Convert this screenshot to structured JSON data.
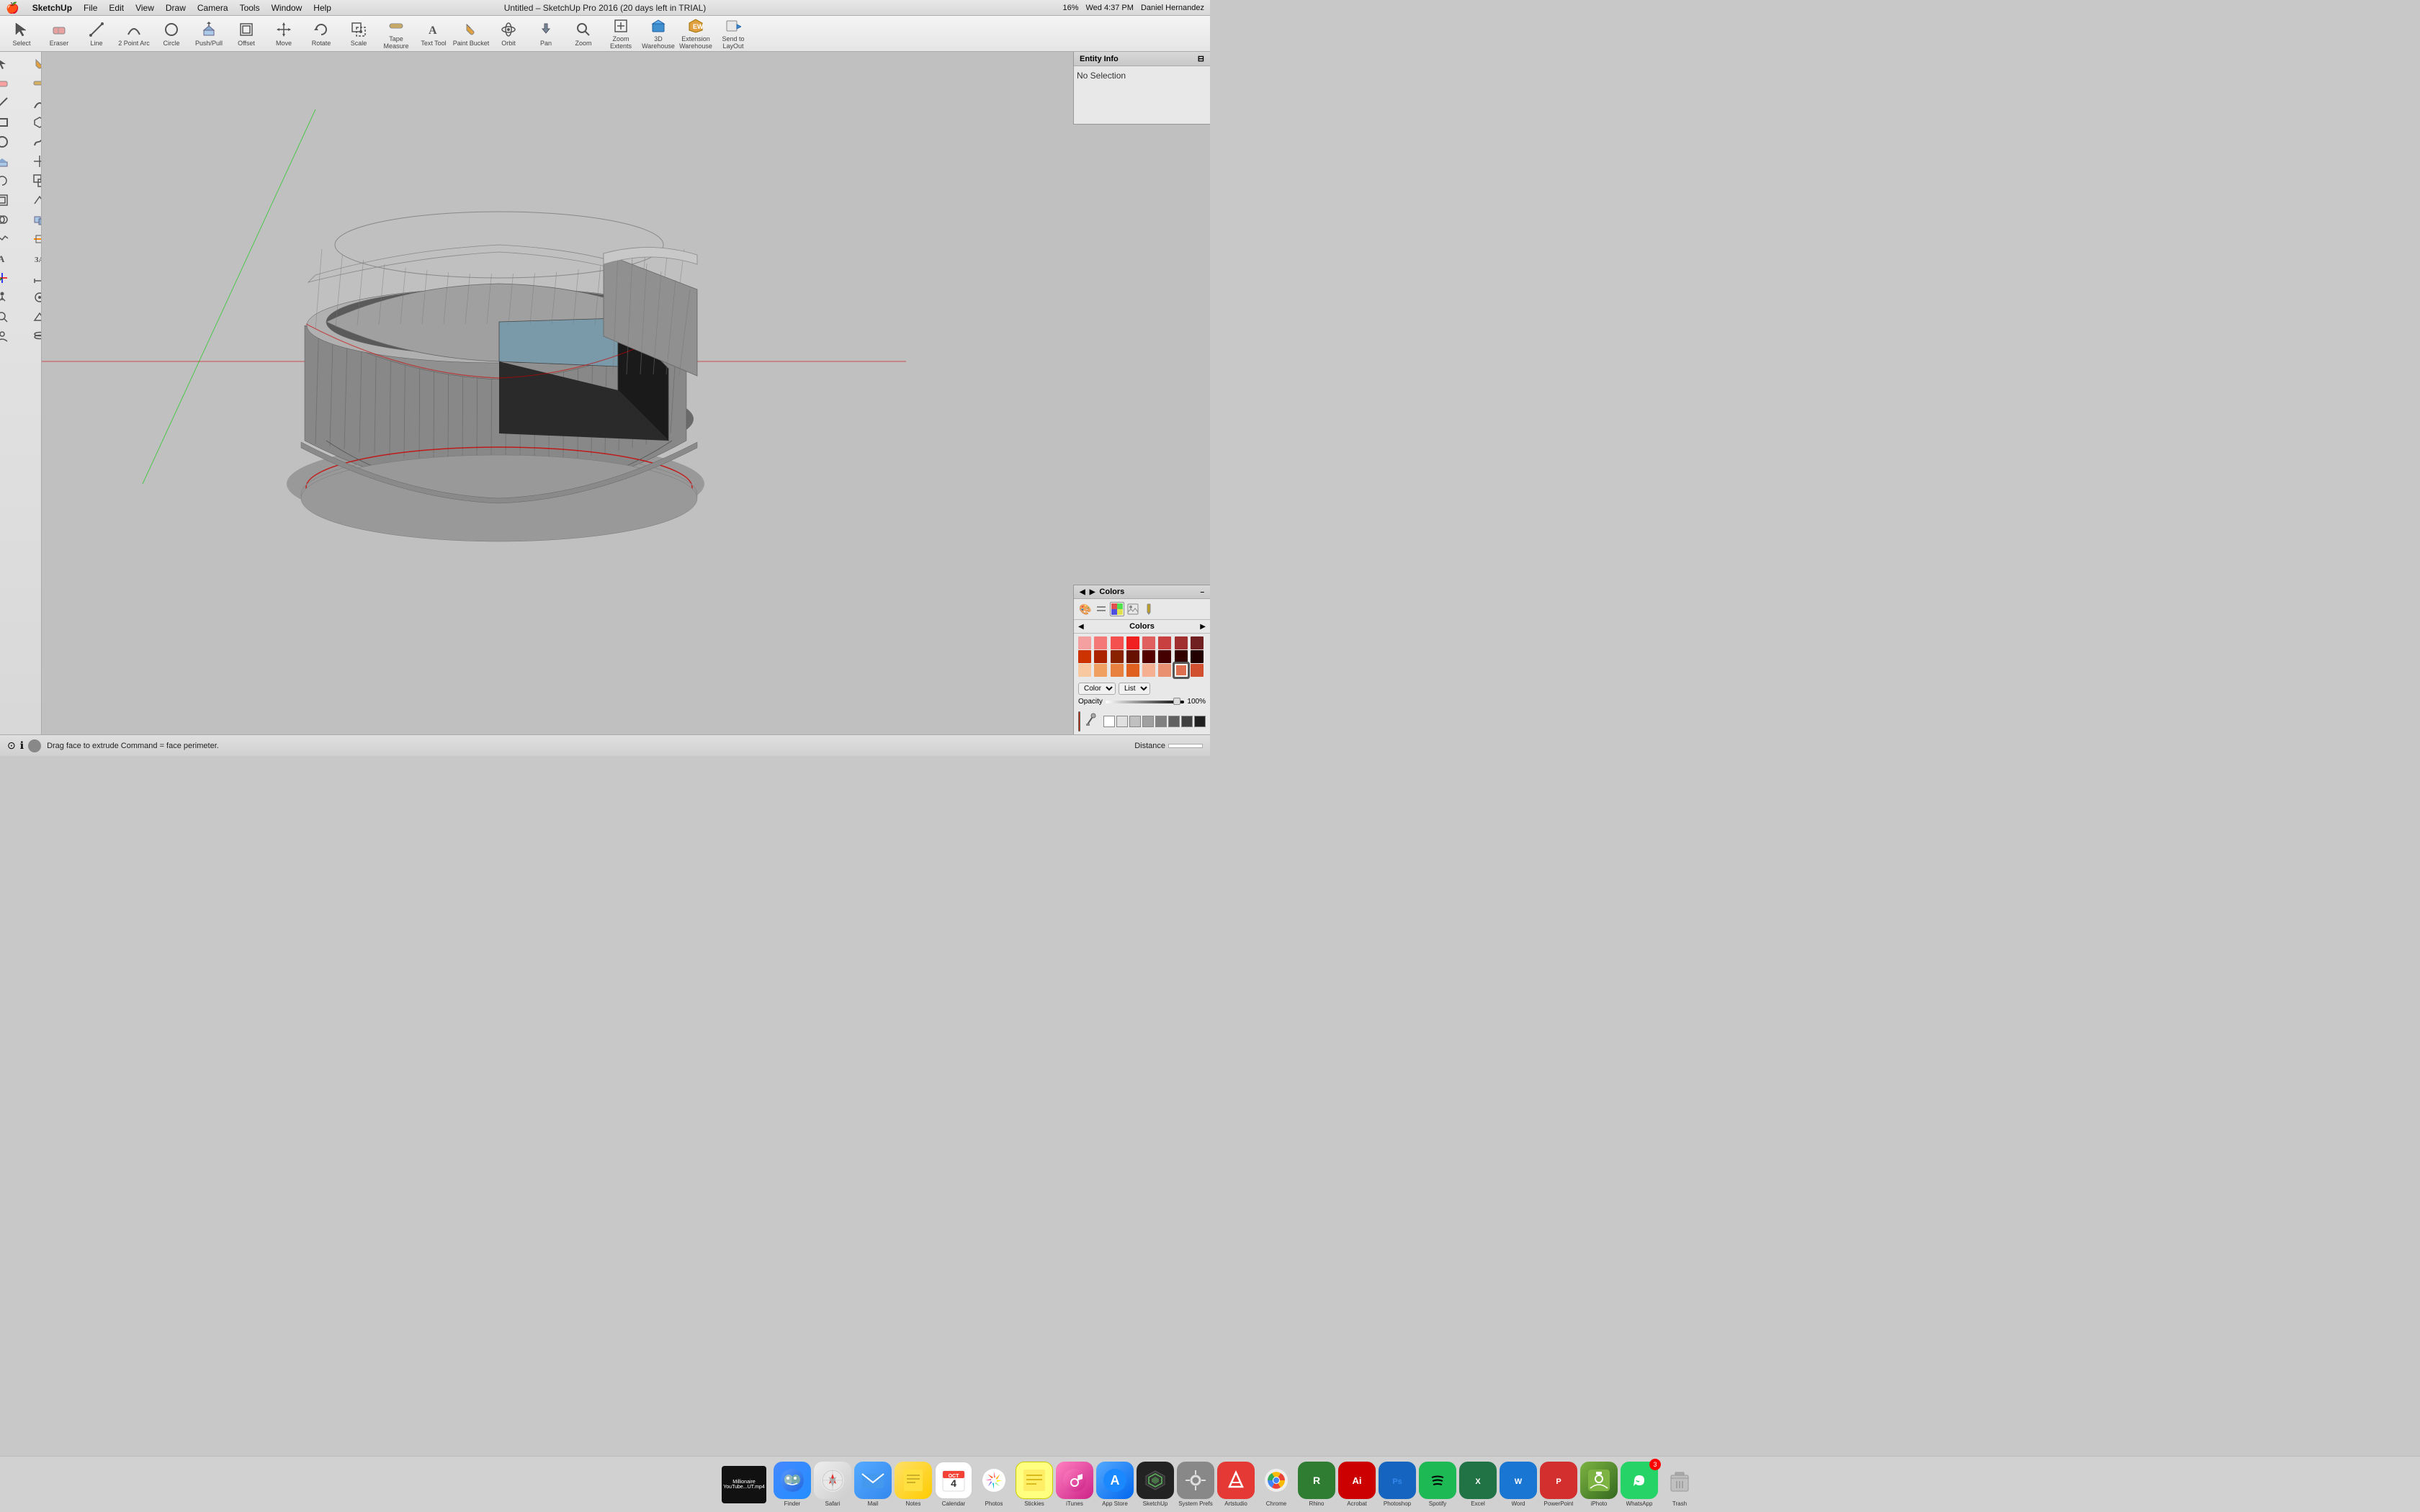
{
  "app": {
    "name": "SketchUp",
    "version": "SketchUp Pro 2016 (20 days left in TRIAL)",
    "document": "Untitled",
    "window_title": "Untitled – SketchUp Pro 2016 (20 days left in TRIAL)"
  },
  "menubar": {
    "apple": "🍎",
    "items": [
      "SketchUp",
      "File",
      "Edit",
      "View",
      "Draw",
      "Camera",
      "Tools",
      "Window",
      "Help"
    ],
    "right": {
      "user": "Daniel Hernandez",
      "time": "Wed 4:37 PM",
      "battery": "16%"
    }
  },
  "toolbar": {
    "tools": [
      {
        "name": "select",
        "label": "Select",
        "icon": "⬡"
      },
      {
        "name": "eraser",
        "label": "Eraser",
        "icon": "⬡"
      },
      {
        "name": "line",
        "label": "Line",
        "icon": "⬡"
      },
      {
        "name": "2point-arc",
        "label": "2 Point Arc",
        "icon": "⬡"
      },
      {
        "name": "circle",
        "label": "Circle",
        "icon": "⬡"
      },
      {
        "name": "push-pull",
        "label": "Push/Pull",
        "icon": "⬡"
      },
      {
        "name": "offset",
        "label": "Offset",
        "icon": "⬡"
      },
      {
        "name": "move",
        "label": "Move",
        "icon": "⬡"
      },
      {
        "name": "rotate",
        "label": "Rotate",
        "icon": "⬡"
      },
      {
        "name": "scale",
        "label": "Scale",
        "icon": "⬡"
      },
      {
        "name": "tape-measure",
        "label": "Tape Measure",
        "icon": "⬡"
      },
      {
        "name": "text-tool",
        "label": "Text Tool",
        "icon": "⬡"
      },
      {
        "name": "paint-bucket",
        "label": "Paint Bucket",
        "icon": "⬡"
      },
      {
        "name": "orbit",
        "label": "Orbit",
        "icon": "⬡"
      },
      {
        "name": "pan",
        "label": "Pan",
        "icon": "⬡"
      },
      {
        "name": "zoom",
        "label": "Zoom",
        "icon": "⬡"
      },
      {
        "name": "zoom-extents",
        "label": "Zoom Extents",
        "icon": "⬡"
      },
      {
        "name": "3d-warehouse",
        "label": "3D Warehouse",
        "icon": "⬡"
      },
      {
        "name": "extension-warehouse",
        "label": "Extension Warehouse",
        "icon": "⬡"
      },
      {
        "name": "send-to-layout",
        "label": "Send to LayOut",
        "icon": "⬡"
      }
    ]
  },
  "entity_info": {
    "title": "Entity Info",
    "no_selection": "No Selection",
    "collapse_icon": "⊟"
  },
  "colors_panel": {
    "title": "Colors",
    "tabs": [
      "🎨",
      "🌈",
      "📋",
      "🖌️",
      "⬛"
    ],
    "section_label": "Colors",
    "swatches": [
      "#f4a0a0",
      "#f47878",
      "#f45050",
      "#f02020",
      "#e06060",
      "#c84040",
      "#a03030",
      "#702020",
      "#cc3300",
      "#aa2200",
      "#882200",
      "#661100",
      "#f8c8a0",
      "#f0a060",
      "#e88040",
      "#e06020",
      "#f4b090",
      "#e89070",
      "#dc7050",
      "#d05030",
      "#c87860",
      "#bc6050",
      "#b04840",
      "#a03030"
    ],
    "color_dropdown": "Color",
    "list_dropdown": "List",
    "opacity_label": "Opacity",
    "opacity_value": "100%",
    "selected_color": "#cc2200",
    "swatches_row": [
      "#ffffff",
      "#f0f0f0",
      "#e0e0e0",
      "#d0d0d0",
      "#c0c0c0",
      "#b0b0b0",
      "#a0a0a0",
      "#888888"
    ]
  },
  "statusbar": {
    "hint": "Drag face to extrude  Command = face perimeter.",
    "distance_label": "Distance"
  },
  "dock": {
    "items": [
      {
        "name": "finder",
        "label": "Finder",
        "color": "#2196F3"
      },
      {
        "name": "safari",
        "label": "Safari",
        "color": "#03A9F4"
      },
      {
        "name": "mail",
        "label": "Mail",
        "color": "#4FC3F7"
      },
      {
        "name": "notes",
        "label": "Notes",
        "color": "#FDD835"
      },
      {
        "name": "calendar",
        "label": "Calendar",
        "color": "#f44336"
      },
      {
        "name": "photos",
        "label": "Photos",
        "color": "#e91e63"
      },
      {
        "name": "stickies",
        "label": "Stickies",
        "color": "#8BC34A"
      },
      {
        "name": "itunes",
        "label": "iTunes",
        "color": "#e91e63"
      },
      {
        "name": "appstore",
        "label": "App Store",
        "color": "#2196F3"
      },
      {
        "name": "sketchup",
        "label": "SketchUp",
        "color": "#4CAF50"
      },
      {
        "name": "system-prefs",
        "label": "System Preferences",
        "color": "#9E9E9E"
      },
      {
        "name": "artstudio",
        "label": "Artstudio",
        "color": "#e53935"
      },
      {
        "name": "chrome",
        "label": "Chrome",
        "color": "#4CAF50"
      },
      {
        "name": "rhino",
        "label": "Rhino",
        "color": "#4CAF50"
      },
      {
        "name": "acrobat",
        "label": "Acrobat",
        "color": "#f44336"
      },
      {
        "name": "photoshop",
        "label": "Photoshop",
        "color": "#1565C0"
      },
      {
        "name": "spotify",
        "label": "Spotify",
        "color": "#388E3C"
      },
      {
        "name": "excel",
        "label": "Excel",
        "color": "#388E3C"
      },
      {
        "name": "word",
        "label": "Word",
        "color": "#1976D2"
      },
      {
        "name": "powerpoint",
        "label": "PowerPoint",
        "color": "#e53935"
      },
      {
        "name": "iphoto",
        "label": "iPhoto",
        "color": "#8BC34A"
      },
      {
        "name": "whatsapp",
        "label": "WhatsApp",
        "color": "#4CAF50"
      },
      {
        "name": "trash",
        "label": "Trash",
        "color": "#9E9E9E"
      }
    ],
    "video_label": "Millionaire YouTube...UT.mp4"
  }
}
